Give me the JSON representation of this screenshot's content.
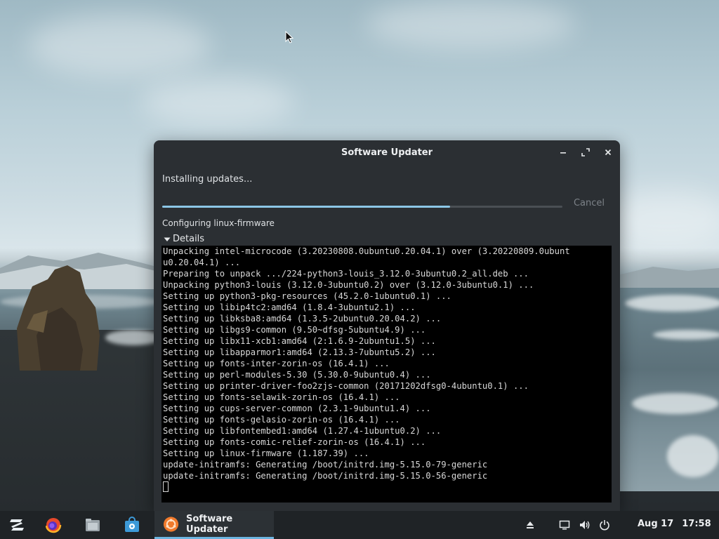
{
  "window": {
    "title": "Software Updater",
    "status": "Installing updates...",
    "progress_fraction": 0.72,
    "cancel_label": "Cancel",
    "current_step": "Configuring linux-firmware",
    "details_label": "Details",
    "terminal_lines": [
      "Unpacking intel-microcode (3.20230808.0ubuntu0.20.04.1) over (3.20220809.0ubunt",
      "u0.20.04.1) ...",
      "Preparing to unpack .../224-python3-louis_3.12.0-3ubuntu0.2_all.deb ...",
      "Unpacking python3-louis (3.12.0-3ubuntu0.2) over (3.12.0-3ubuntu0.1) ...",
      "Setting up python3-pkg-resources (45.2.0-1ubuntu0.1) ...",
      "Setting up libip4tc2:amd64 (1.8.4-3ubuntu2.1) ...",
      "Setting up libksba8:amd64 (1.3.5-2ubuntu0.20.04.2) ...",
      "Setting up libgs9-common (9.50~dfsg-5ubuntu4.9) ...",
      "Setting up libx11-xcb1:amd64 (2:1.6.9-2ubuntu1.5) ...",
      "Setting up libapparmor1:amd64 (2.13.3-7ubuntu5.2) ...",
      "Setting up fonts-inter-zorin-os (16.4.1) ...",
      "Setting up perl-modules-5.30 (5.30.0-9ubuntu0.4) ...",
      "Setting up printer-driver-foo2zjs-common (20171202dfsg0-4ubuntu0.1) ...",
      "Setting up fonts-selawik-zorin-os (16.4.1) ...",
      "Setting up cups-server-common (2.3.1-9ubuntu1.4) ...",
      "Setting up fonts-gelasio-zorin-os (16.4.1) ...",
      "Setting up libfontembed1:amd64 (1.27.4-1ubuntu0.2) ...",
      "Setting up fonts-comic-relief-zorin-os (16.4.1) ...",
      "Setting up linux-firmware (1.187.39) ...",
      "update-initramfs: Generating /boot/initrd.img-5.15.0-79-generic",
      "update-initramfs: Generating /boot/initrd.img-5.15.0-56-generic"
    ]
  },
  "taskbar": {
    "active_app_label": "Software Updater",
    "clock_date": "Aug 17",
    "clock_time": "17:58"
  },
  "colors": {
    "accent": "#6cb5e0",
    "progress": "#8cc6e6",
    "window_bg": "#2b2f33",
    "taskbar_bg": "#1f2326"
  },
  "icons": {
    "zorin_menu": "zorin-logo-icon",
    "browser": "firefox-icon",
    "files": "folder-icon",
    "store": "software-store-icon",
    "updater": "software-updater-icon",
    "eject": "eject-icon",
    "display": "display-icon",
    "volume": "volume-icon",
    "power": "power-icon"
  }
}
